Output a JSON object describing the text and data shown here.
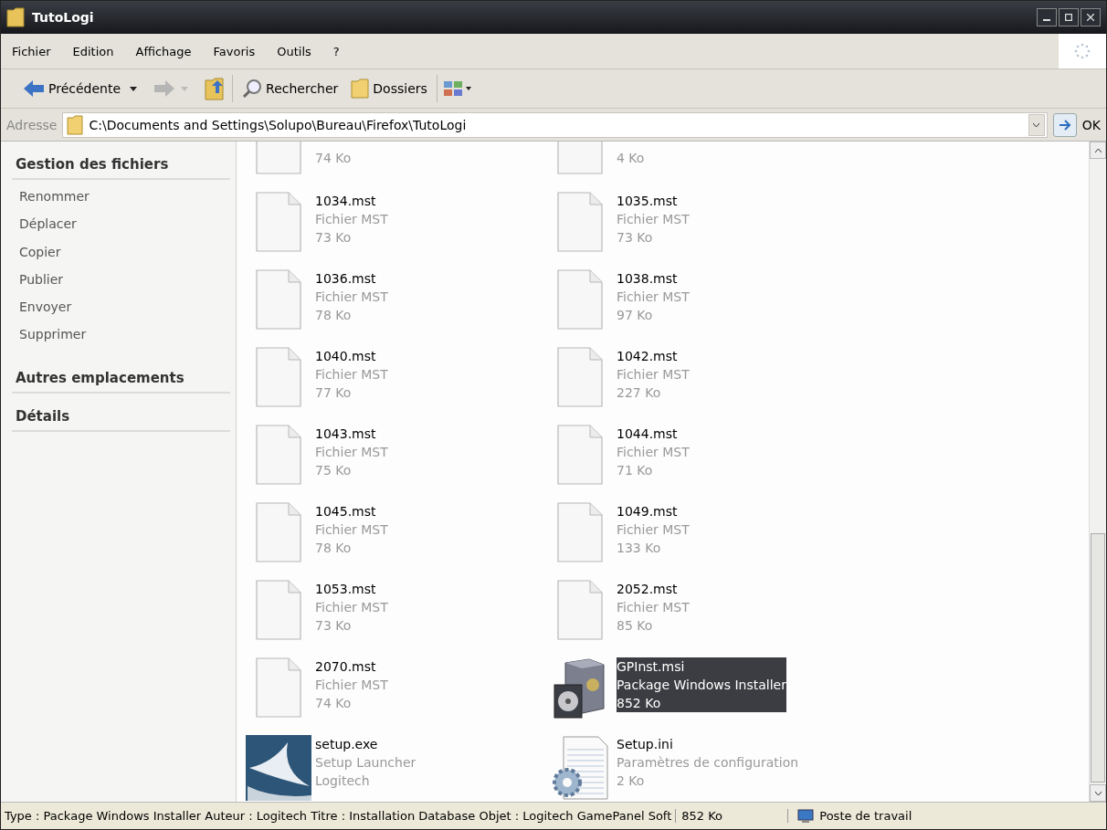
{
  "window": {
    "title": "TutoLogi"
  },
  "menu": [
    "Fichier",
    "Edition",
    "Affichage",
    "Favoris",
    "Outils",
    "?"
  ],
  "toolbar": {
    "back": "Précédente",
    "search": "Rechercher",
    "folders": "Dossiers"
  },
  "address": {
    "label": "Adresse",
    "value": "C:\\Documents and Settings\\Solupo\\Bureau\\Firefox\\TutoLogi",
    "go": "OK"
  },
  "sidebar": [
    {
      "title": "Gestion des fichiers",
      "items": [
        "Renommer",
        "Déplacer",
        "Copier",
        "Publier",
        "Envoyer",
        "Supprimer"
      ]
    },
    {
      "title": "Autres emplacements"
    },
    {
      "title": "Détails"
    }
  ],
  "files": [
    {
      "kind": "partial",
      "lines": [
        "74 Ko"
      ],
      "selected": false
    },
    {
      "kind": "partial",
      "lines": [
        "4 Ko"
      ],
      "selected": false
    },
    {
      "kind": "mst",
      "lines": [
        "1034.mst",
        "Fichier MST",
        "73 Ko"
      ],
      "selected": false
    },
    {
      "kind": "mst",
      "lines": [
        "1035.mst",
        "Fichier MST",
        "73 Ko"
      ],
      "selected": false
    },
    {
      "kind": "mst",
      "lines": [
        "1036.mst",
        "Fichier MST",
        "78 Ko"
      ],
      "selected": false
    },
    {
      "kind": "mst",
      "lines": [
        "1038.mst",
        "Fichier MST",
        "97 Ko"
      ],
      "selected": false
    },
    {
      "kind": "mst",
      "lines": [
        "1040.mst",
        "Fichier MST",
        "77 Ko"
      ],
      "selected": false
    },
    {
      "kind": "mst",
      "lines": [
        "1042.mst",
        "Fichier MST",
        "227 Ko"
      ],
      "selected": false
    },
    {
      "kind": "mst",
      "lines": [
        "1043.mst",
        "Fichier MST",
        "75 Ko"
      ],
      "selected": false
    },
    {
      "kind": "mst",
      "lines": [
        "1044.mst",
        "Fichier MST",
        "71 Ko"
      ],
      "selected": false
    },
    {
      "kind": "mst",
      "lines": [
        "1045.mst",
        "Fichier MST",
        "78 Ko"
      ],
      "selected": false
    },
    {
      "kind": "mst",
      "lines": [
        "1049.mst",
        "Fichier MST",
        "133 Ko"
      ],
      "selected": false
    },
    {
      "kind": "mst",
      "lines": [
        "1053.mst",
        "Fichier MST",
        "73 Ko"
      ],
      "selected": false
    },
    {
      "kind": "mst",
      "lines": [
        "2052.mst",
        "Fichier MST",
        "85 Ko"
      ],
      "selected": false
    },
    {
      "kind": "mst",
      "lines": [
        "2070.mst",
        "Fichier MST",
        "74 Ko"
      ],
      "selected": false
    },
    {
      "kind": "msi",
      "lines": [
        "GPInst.msi",
        "Package Windows Installer",
        "852 Ko"
      ],
      "selected": true
    },
    {
      "kind": "exe",
      "lines": [
        "setup.exe",
        "Setup Launcher",
        "Logitech"
      ],
      "selected": false
    },
    {
      "kind": "ini",
      "lines": [
        "Setup.ini",
        "Paramètres de configuration",
        "2 Ko"
      ],
      "selected": false
    }
  ],
  "status_bar": [
    "Type : Package Windows Installer Auteur : Logitech Titre : Installation Database Objet  : Logitech GamePanel Soft",
    "852 Ko",
    "Poste de travail"
  ]
}
